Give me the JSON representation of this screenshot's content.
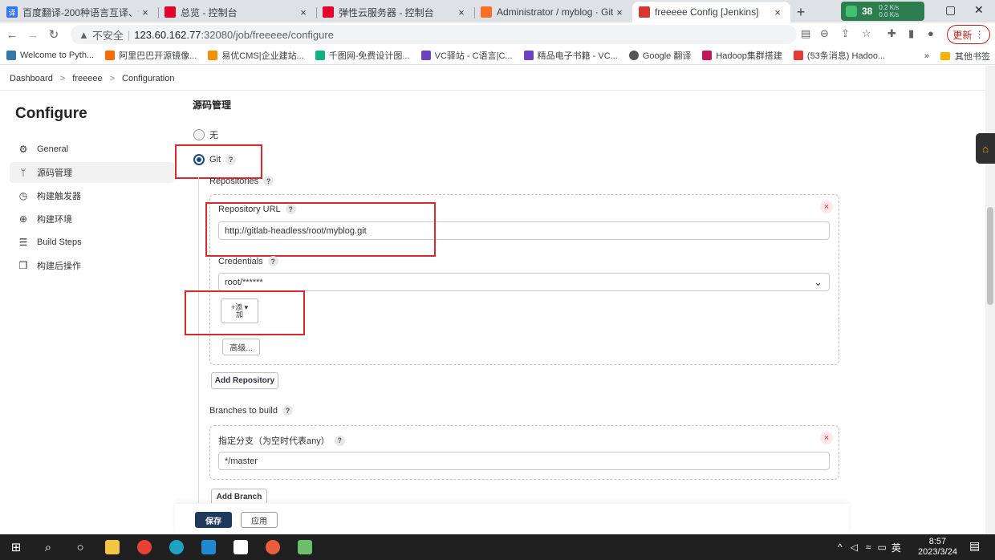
{
  "tabs": [
    {
      "title": "百度翻译-200种语言互译、沟通全",
      "icon": "baidu-translate-icon",
      "color": "#2f74ff",
      "glyph": "译"
    },
    {
      "title": "总览 - 控制台",
      "icon": "huawei-icon",
      "color": "#e4002b",
      "glyph": ""
    },
    {
      "title": "弹性云服务器 - 控制台",
      "icon": "huawei-icon",
      "color": "#e4002b",
      "glyph": ""
    },
    {
      "title": "Administrator / myblog · GitLab",
      "icon": "gitlab-icon",
      "color": "#fc6d26",
      "glyph": ""
    },
    {
      "title": "freeeee Config [Jenkins]",
      "icon": "jenkins-icon",
      "color": "#d33833",
      "glyph": ""
    }
  ],
  "netmon": {
    "percent": "38",
    "up": "0.2 K/s",
    "down": "0.0 K/s"
  },
  "address": {
    "warning": "▲",
    "insecure": "不安全",
    "host": "123.60.162.77",
    "path": ":32080/job/freeeee/configure"
  },
  "update_label": "更新",
  "bookmarks": [
    {
      "label": "Welcome to Pyth...",
      "color": "#3776ab"
    },
    {
      "label": "阿里巴巴开源镜像...",
      "color": "#ff6a00"
    },
    {
      "label": "易优CMS|企业建站...",
      "color": "#f29100"
    },
    {
      "label": "千图网-免费设计图...",
      "color": "#0fb27f"
    },
    {
      "label": "VC驿站 - C语言|C...",
      "color": "#6a42c2"
    },
    {
      "label": "精品电子书籍 - VC...",
      "color": "#6a42c2"
    },
    {
      "label": "Google 翻译",
      "color": "#555555"
    },
    {
      "label": "Hadoop集群搭建",
      "color": "#c2185b"
    },
    {
      "label": "(53条消息) Hadoo...",
      "color": "#e53935"
    }
  ],
  "bookmarks_more": "»",
  "bookmarks_other": "其他书签",
  "breadcrumb": {
    "items": [
      "Dashboard",
      "freeeee",
      "Configuration"
    ],
    "sep": ">"
  },
  "page_title": "Configure",
  "sidebar": [
    {
      "label": "General",
      "icon": "gear-icon",
      "glyph": "⚙"
    },
    {
      "label": "源码管理",
      "icon": "branch-icon",
      "glyph": "ᛘ"
    },
    {
      "label": "构建触发器",
      "icon": "clock-icon",
      "glyph": "◷"
    },
    {
      "label": "构建环境",
      "icon": "globe-icon",
      "glyph": "⊕"
    },
    {
      "label": "Build Steps",
      "icon": "list-icon",
      "glyph": "☰"
    },
    {
      "label": "构建后操作",
      "icon": "cube-icon",
      "glyph": "❒"
    }
  ],
  "scm": {
    "section_title": "源码管理",
    "none_label": "无",
    "git_label": "Git",
    "help": "?",
    "repositories_label": "Repositories",
    "repo_url_label": "Repository URL",
    "repo_url_value": "http://gitlab-headless/root/myblog.git",
    "credentials_label": "Credentials",
    "credentials_value": "root/******",
    "add_label_top": "添",
    "add_label_bottom": "加",
    "advanced_label": "高级...",
    "add_repository": "Add Repository",
    "branches_label": "Branches to build",
    "branch_spec_label": "指定分支（为空时代表any）",
    "branch_value": "*/master",
    "add_branch": "Add Branch",
    "remove": "×"
  },
  "actions": {
    "save": "保存",
    "apply": "应用"
  },
  "taskbar": {
    "tray_text": "英",
    "time": "8:57",
    "date": "2023/3/24",
    "notif": "1"
  }
}
